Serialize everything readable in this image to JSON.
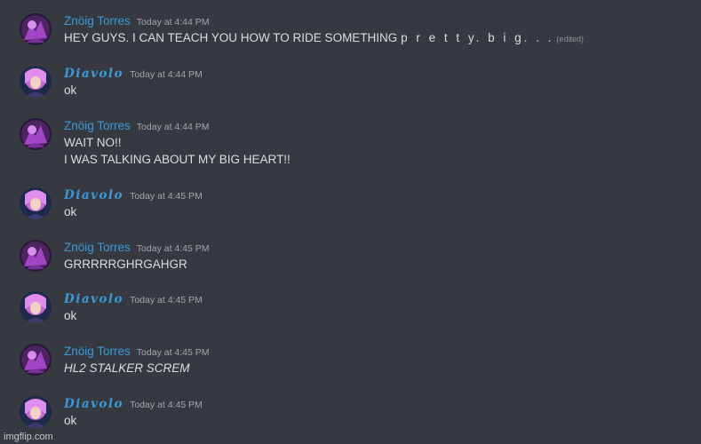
{
  "messages": [
    {
      "user": "Znöig Torres",
      "avatar": "avatar-torres",
      "time": "Today at 4:44 PM",
      "lines": [
        "HEY GUYS. I CAN TEACH YOU HOW TO RIDE SOMETHING "
      ],
      "spaced": "p r e t t y. b i  g. . .",
      "edited": "(edited)"
    },
    {
      "user": "Diavolo",
      "avatar": "avatar-diavolo",
      "time": "Today at 4:44 PM",
      "lines": [
        "ok"
      ]
    },
    {
      "user": "Znöig Torres",
      "avatar": "avatar-torres",
      "time": "Today at 4:44 PM",
      "lines": [
        "WAIT NO!!",
        "I WAS TALKING ABOUT MY BIG HEART!!"
      ]
    },
    {
      "user": "Diavolo",
      "avatar": "avatar-diavolo",
      "time": "Today at 4:45 PM",
      "lines": [
        "ok"
      ]
    },
    {
      "user": "Znöig Torres",
      "avatar": "avatar-torres",
      "time": "Today at 4:45 PM",
      "lines": [
        "GRRRRRGHRGAHGR"
      ]
    },
    {
      "user": "Diavolo",
      "avatar": "avatar-diavolo",
      "time": "Today at 4:45 PM",
      "lines": [
        "ok"
      ]
    },
    {
      "user": "Znöig Torres",
      "avatar": "avatar-torres",
      "time": "Today at 4:45 PM",
      "lines": [
        "HL2 STALKER SCREM"
      ],
      "italic": true
    },
    {
      "user": "Diavolo",
      "avatar": "avatar-diavolo",
      "time": "Today at 4:45 PM",
      "lines": [
        "ok"
      ]
    }
  ],
  "colors": {
    "background": "#36393f",
    "username": "#3a9ad9",
    "text": "#dcddde",
    "timestamp": "#a3a6aa"
  },
  "watermark": "imgflip.com"
}
